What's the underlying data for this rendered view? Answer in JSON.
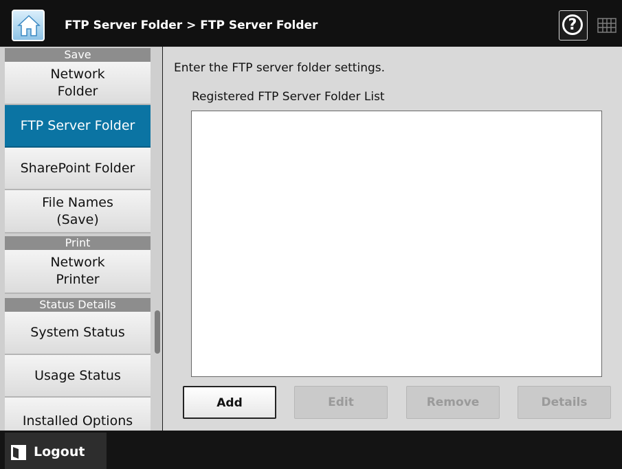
{
  "header": {
    "title": "FTP Server Folder > FTP Server Folder",
    "home_icon": "home-icon",
    "help_icon": "help-icon",
    "keyboard_icon": "keyboard-icon"
  },
  "sidebar": {
    "sections": [
      {
        "header": "Save",
        "items": [
          "Network Folder",
          "FTP Server Folder",
          "SharePoint Folder",
          "File Names (Save)"
        ]
      },
      {
        "header": "Print",
        "items": [
          "Network Printer"
        ]
      },
      {
        "header": "Status Details",
        "items": [
          "System Status",
          "Usage Status",
          "Installed Options"
        ]
      }
    ],
    "active_item": "FTP Server Folder"
  },
  "main": {
    "instruction": "Enter the FTP server folder settings.",
    "list_label": "Registered FTP Server Folder List",
    "list_items": [],
    "buttons": {
      "add": "Add",
      "edit": "Edit",
      "remove": "Remove",
      "details": "Details"
    }
  },
  "footer": {
    "logout_label": "Logout",
    "logout_icon": "logout-icon"
  },
  "colors": {
    "active_nav": "#0b74a3",
    "titlebar": "#111111",
    "section_header": "#8d8d8d"
  }
}
